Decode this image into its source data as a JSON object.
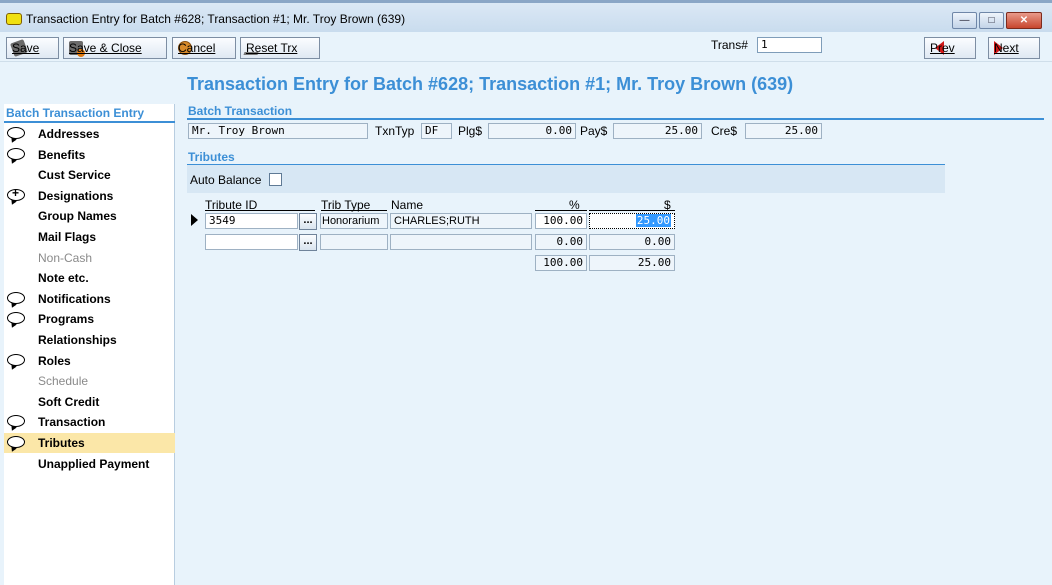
{
  "window": {
    "title": "Transaction Entry for Batch #628; Transaction #1; Mr. Troy Brown (639)"
  },
  "toolbar": {
    "save_label": "Save",
    "save_close_label": "Save & Close",
    "cancel_label": "Cancel",
    "reset_label": "Reset Trx",
    "trans_label": "Trans#",
    "trans_value": "1",
    "prev_label": "Prev",
    "next_label": "Next"
  },
  "heading": "Transaction Entry for Batch #628; Transaction #1; Mr. Troy Brown (639)",
  "sidebar": {
    "title": "Batch Transaction Entry",
    "items": [
      {
        "label": "Addresses",
        "icon": "comment",
        "state": "normal"
      },
      {
        "label": "Benefits",
        "icon": "comment",
        "state": "normal"
      },
      {
        "label": "Cust Service",
        "icon": "",
        "state": "normal"
      },
      {
        "label": "Designations",
        "icon": "comment-plus",
        "state": "normal"
      },
      {
        "label": "Group Names",
        "icon": "",
        "state": "normal"
      },
      {
        "label": "Mail Flags",
        "icon": "",
        "state": "normal"
      },
      {
        "label": "Non-Cash",
        "icon": "",
        "state": "disabled"
      },
      {
        "label": "Note etc.",
        "icon": "",
        "state": "normal"
      },
      {
        "label": "Notifications",
        "icon": "comment",
        "state": "normal"
      },
      {
        "label": "Programs",
        "icon": "comment",
        "state": "normal"
      },
      {
        "label": "Relationships",
        "icon": "",
        "state": "normal"
      },
      {
        "label": "Roles",
        "icon": "comment",
        "state": "normal"
      },
      {
        "label": "Schedule",
        "icon": "",
        "state": "disabled"
      },
      {
        "label": "Soft Credit",
        "icon": "",
        "state": "normal"
      },
      {
        "label": "Transaction",
        "icon": "comment",
        "state": "normal"
      },
      {
        "label": "Tributes",
        "icon": "comment",
        "state": "active"
      },
      {
        "label": "Unapplied Payment",
        "icon": "",
        "state": "normal"
      }
    ]
  },
  "batch": {
    "title": "Batch Transaction",
    "name": "Mr. Troy Brown",
    "txntyp_label": "TxnTyp",
    "txntyp": "DF",
    "plg_label": "Plg$",
    "plg": "0.00",
    "pay_label": "Pay$",
    "pay": "25.00",
    "cre_label": "Cre$",
    "cre": "25.00"
  },
  "tributes": {
    "title": "Tributes",
    "auto_balance_label": "Auto Balance",
    "auto_balance": false,
    "columns": {
      "id": "Tribute ID",
      "type": "Trib Type",
      "name": "Name",
      "pct": "%",
      "amt": "$"
    },
    "rows": [
      {
        "id": "3549",
        "type": "Honorarium",
        "name": "CHARLES;RUTH",
        "pct": "100.00",
        "amt": "25.00"
      },
      {
        "id": "",
        "type": "",
        "name": "",
        "pct": "0.00",
        "amt": "0.00"
      }
    ],
    "totals": {
      "pct": "100.00",
      "amt": "25.00"
    },
    "ellipsis": "..."
  }
}
